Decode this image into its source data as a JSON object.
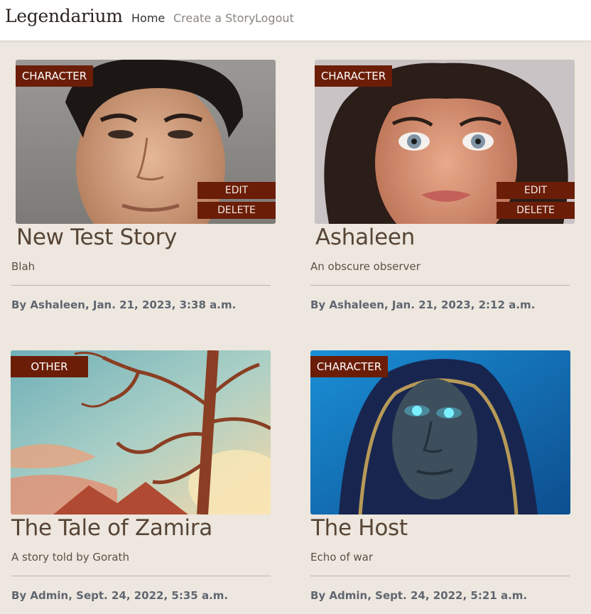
{
  "nav": {
    "brand": "Legendarium",
    "links": [
      "Home",
      "Create a Story",
      "Logout"
    ]
  },
  "cards": [
    {
      "category": "CHARACTER",
      "title": "New Test Story",
      "description": "Blah",
      "meta": "By Ashaleen, Jan. 21, 2023, 3:38 a.m.",
      "edit_label": "EDIT",
      "delete_label": "DELETE"
    },
    {
      "category": "CHARACTER",
      "title": "Ashaleen",
      "description": "An obscure observer",
      "meta": "By Ashaleen, Jan. 21, 2023, 2:12 a.m.",
      "edit_label": "EDIT",
      "delete_label": "DELETE"
    },
    {
      "category": "OTHER",
      "title": "The Tale of Zamira",
      "description": "A story told by Gorath",
      "meta": "By Admin, Sept. 24, 2022, 5:35 a.m."
    },
    {
      "category": "CHARACTER",
      "title": "The Host",
      "description": "Echo of war",
      "meta": "By Admin, Sept. 24, 2022, 5:21 a.m."
    }
  ]
}
